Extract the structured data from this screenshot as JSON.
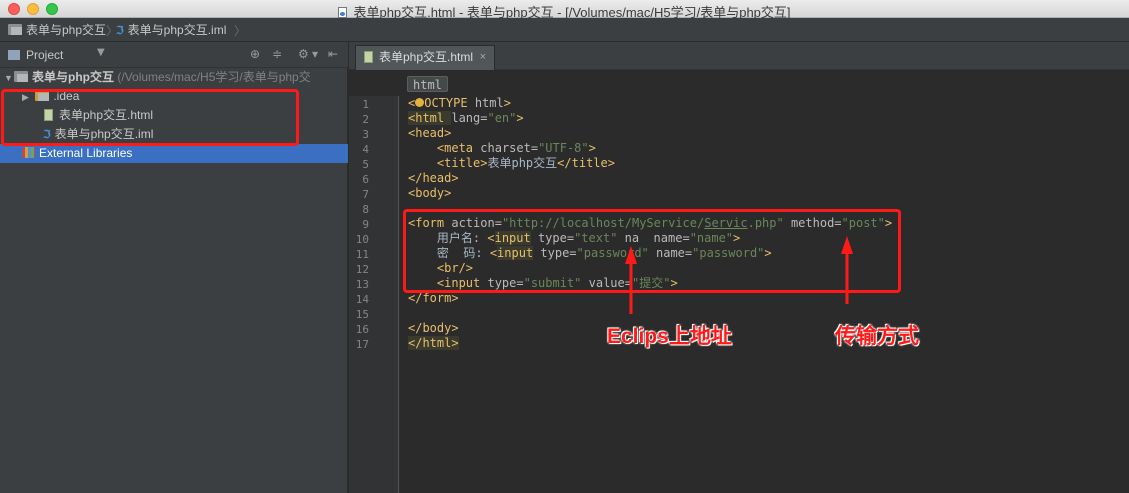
{
  "window": {
    "title": "表单php交互.html - 表单与php交互 - [/Volumes/mac/H5学习/表单与php交互]"
  },
  "navbar": {
    "crumbs": [
      "表单与php交互",
      "表单与php交互.iml"
    ]
  },
  "project": {
    "label": "Project",
    "root_name": "表单与php交互",
    "root_path": "(/Volumes/mac/H5学习/表单与php交",
    "items": [
      {
        "label": ".idea"
      },
      {
        "label": "表单php交互.html"
      },
      {
        "label": "表单与php交互.iml"
      }
    ],
    "external": "External Libraries"
  },
  "editor": {
    "tab_label": "表单php交互.html",
    "tag_breadcrumb": "html",
    "line_numbers": [
      "1",
      "2",
      "3",
      "4",
      "5",
      "6",
      "7",
      "8",
      "9",
      "10",
      "11",
      "12",
      "13",
      "14",
      "15",
      "16",
      "17"
    ]
  },
  "annotations": {
    "url_label": "Eclips上地址",
    "method_label": "传输方式"
  },
  "colors": {
    "annotation": "#ff1a1a",
    "selection": "#3a6fc2"
  }
}
